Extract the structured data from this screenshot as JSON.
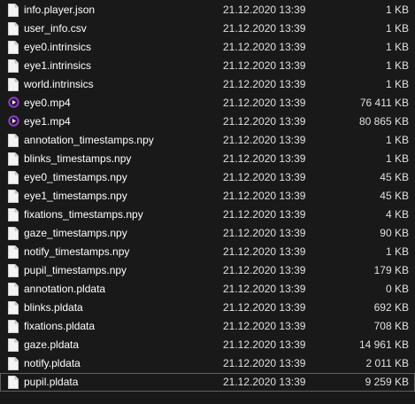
{
  "colors": {
    "background": "#191919",
    "text": "#ffffff",
    "secondary_text": "#e0e0e0",
    "media_icon": "#8a3fc4",
    "selected_outline": "#5f5f5f"
  },
  "files": [
    {
      "name": "info.player.json",
      "date": "21.12.2020 13:39",
      "size": "1 KB",
      "icon": "document-icon"
    },
    {
      "name": "user_info.csv",
      "date": "21.12.2020 13:39",
      "size": "1 KB",
      "icon": "document-icon"
    },
    {
      "name": "eye0.intrinsics",
      "date": "21.12.2020 13:39",
      "size": "1 KB",
      "icon": "document-icon"
    },
    {
      "name": "eye1.intrinsics",
      "date": "21.12.2020 13:39",
      "size": "1 KB",
      "icon": "document-icon"
    },
    {
      "name": "world.intrinsics",
      "date": "21.12.2020 13:39",
      "size": "1 KB",
      "icon": "document-icon"
    },
    {
      "name": "eye0.mp4",
      "date": "21.12.2020 13:39",
      "size": "76 411 KB",
      "icon": "media-player-icon"
    },
    {
      "name": "eye1.mp4",
      "date": "21.12.2020 13:39",
      "size": "80 865 KB",
      "icon": "media-player-icon"
    },
    {
      "name": "annotation_timestamps.npy",
      "date": "21.12.2020 13:39",
      "size": "1 KB",
      "icon": "document-icon"
    },
    {
      "name": "blinks_timestamps.npy",
      "date": "21.12.2020 13:39",
      "size": "1 KB",
      "icon": "document-icon"
    },
    {
      "name": "eye0_timestamps.npy",
      "date": "21.12.2020 13:39",
      "size": "45 KB",
      "icon": "document-icon"
    },
    {
      "name": "eye1_timestamps.npy",
      "date": "21.12.2020 13:39",
      "size": "45 KB",
      "icon": "document-icon"
    },
    {
      "name": "fixations_timestamps.npy",
      "date": "21.12.2020 13:39",
      "size": "4 KB",
      "icon": "document-icon"
    },
    {
      "name": "gaze_timestamps.npy",
      "date": "21.12.2020 13:39",
      "size": "90 KB",
      "icon": "document-icon"
    },
    {
      "name": "notify_timestamps.npy",
      "date": "21.12.2020 13:39",
      "size": "1 KB",
      "icon": "document-icon"
    },
    {
      "name": "pupil_timestamps.npy",
      "date": "21.12.2020 13:39",
      "size": "179 KB",
      "icon": "document-icon"
    },
    {
      "name": "annotation.pldata",
      "date": "21.12.2020 13:39",
      "size": "0 KB",
      "icon": "document-icon"
    },
    {
      "name": "blinks.pldata",
      "date": "21.12.2020 13:39",
      "size": "692 KB",
      "icon": "document-icon"
    },
    {
      "name": "fixations.pldata",
      "date": "21.12.2020 13:39",
      "size": "708 KB",
      "icon": "document-icon"
    },
    {
      "name": "gaze.pldata",
      "date": "21.12.2020 13:39",
      "size": "14 961 KB",
      "icon": "document-icon"
    },
    {
      "name": "notify.pldata",
      "date": "21.12.2020 13:39",
      "size": "2 011 KB",
      "icon": "document-icon"
    },
    {
      "name": "pupil.pldata",
      "date": "21.12.2020 13:39",
      "size": "9 259 KB",
      "icon": "document-icon",
      "selected": true
    }
  ]
}
